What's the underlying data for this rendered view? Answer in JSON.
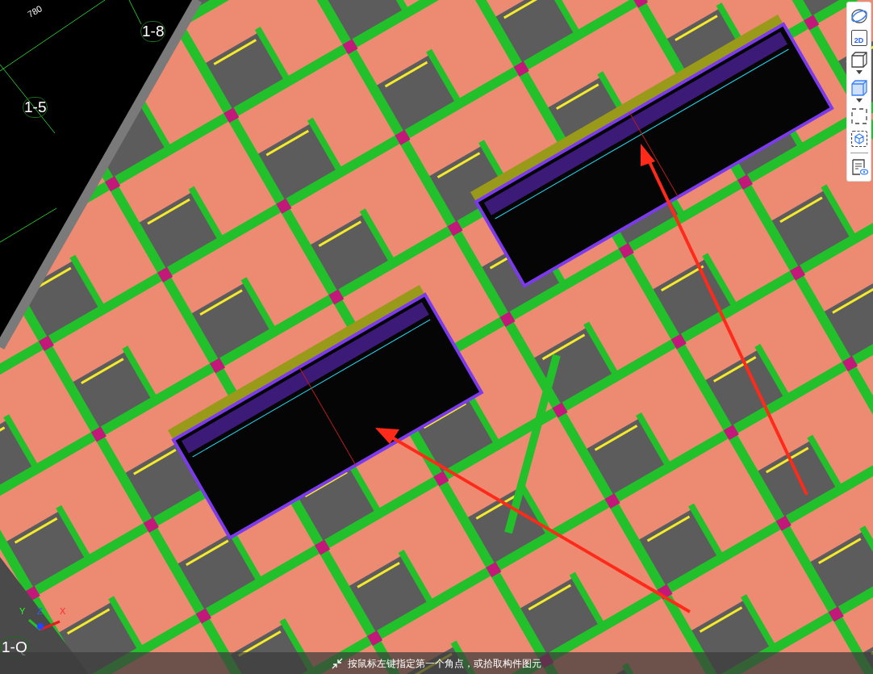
{
  "viewport": {
    "dimension_label": "780",
    "grid_labels": [
      {
        "text": "1-8"
      },
      {
        "text": "1-5"
      },
      {
        "text": "1-Q"
      }
    ],
    "axes": {
      "x": "X",
      "y": "Y",
      "z": "Z"
    }
  },
  "toolbar": [
    {
      "kind": "orbit"
    },
    {
      "kind": "text",
      "label": "2D"
    },
    {
      "kind": "box",
      "dropdown": true
    },
    {
      "kind": "box-filled",
      "dropdown": true
    },
    {
      "kind": "select"
    },
    {
      "kind": "select-cube"
    },
    {
      "kind": "divider"
    },
    {
      "kind": "list-eye"
    }
  ],
  "status_bar": {
    "text": "按鼠标左键指定第一个角点，或拾取构件图元"
  }
}
